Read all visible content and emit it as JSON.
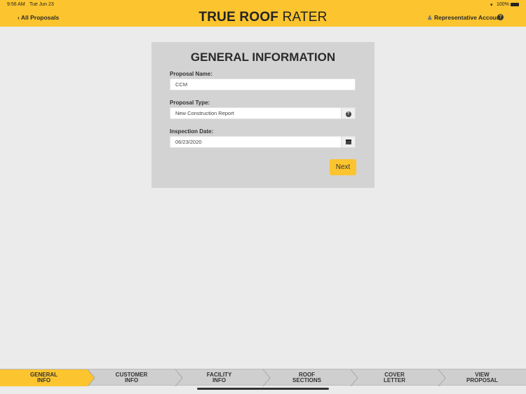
{
  "status_bar": {
    "time": "9:56 AM",
    "date": "Tue Jun 23",
    "battery": "100%"
  },
  "header": {
    "back_label": "All Proposals",
    "title_bold": "TRUE ROOF",
    "title_light": "RATER",
    "account": "Representative Account"
  },
  "form": {
    "title": "GENERAL INFORMATION",
    "name_label": "Proposal Name:",
    "name_value": "CCM",
    "type_label": "Proposal Type:",
    "type_value": "New Construction Report",
    "date_label": "Inspection Date:",
    "date_value": "06/23/2020",
    "next_label": "Next"
  },
  "tabs": [
    {
      "l1": "GENERAL",
      "l2": "INFO"
    },
    {
      "l1": "CUSTOMER",
      "l2": "INFO"
    },
    {
      "l1": "FACILITY",
      "l2": "INFO"
    },
    {
      "l1": "ROOF",
      "l2": "SECTIONS"
    },
    {
      "l1": "COVER",
      "l2": "LETTER"
    },
    {
      "l1": "VIEW",
      "l2": "PROPOSAL"
    }
  ],
  "colors": {
    "accent": "#fcc42e",
    "card": "#d3d3d3",
    "background": "#ebebeb"
  }
}
